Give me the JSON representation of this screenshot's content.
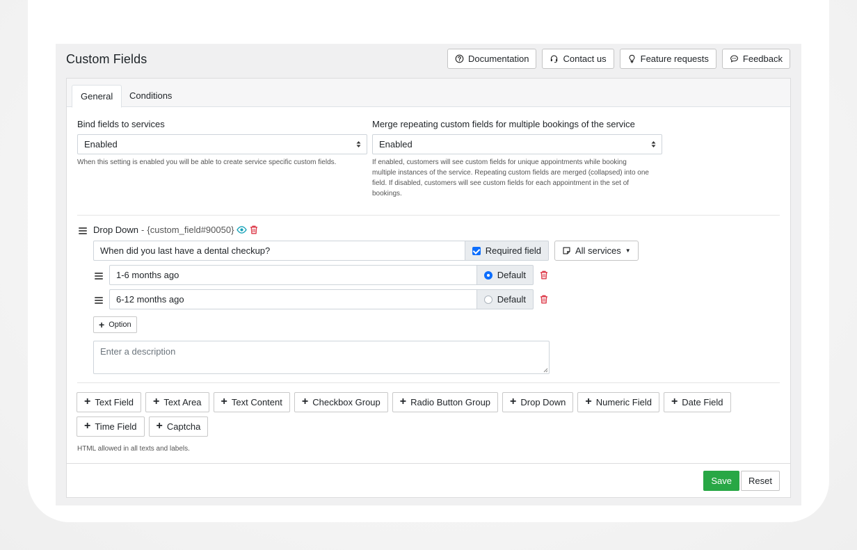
{
  "header": {
    "title": "Custom Fields",
    "buttons": [
      {
        "label": "Documentation",
        "icon": "question-circle-icon"
      },
      {
        "label": "Contact us",
        "icon": "headset-icon"
      },
      {
        "label": "Feature requests",
        "icon": "lightbulb-icon"
      },
      {
        "label": "Feedback",
        "icon": "chat-icon"
      }
    ]
  },
  "tabs": [
    {
      "label": "General",
      "active": true
    },
    {
      "label": "Conditions",
      "active": false
    }
  ],
  "settings": {
    "bind": {
      "label": "Bind fields to services",
      "value": "Enabled",
      "help": "When this setting is enabled you will be able to create service specific custom fields."
    },
    "merge": {
      "label": "Merge repeating custom fields for multiple bookings of the service",
      "value": "Enabled",
      "help_lines": [
        "If enabled, customers will see custom fields for unique appointments while booking",
        "multiple instances of the service. Repeating custom fields are merged (collapsed) into one",
        "field. If disabled, customers will see custom fields for each appointment in the set of",
        "bookings."
      ]
    }
  },
  "field": {
    "type": "Drop Down",
    "separator": " - ",
    "code": "{custom_field#90050}",
    "question": "When did you last have a dental checkup?",
    "required_label": "Required field",
    "required": true,
    "services_label": "All services",
    "options": [
      {
        "value": "1-6 months ago",
        "default_label": "Default",
        "is_default": true
      },
      {
        "value": "6-12 months ago",
        "default_label": "Default",
        "is_default": false
      }
    ],
    "add_option_label": "Option",
    "description_placeholder": "Enter a description"
  },
  "add_buttons": [
    "Text Field",
    "Text Area",
    "Text Content",
    "Checkbox Group",
    "Radio Button Group",
    "Drop Down",
    "Numeric Field",
    "Date Field",
    "Time Field",
    "Captcha"
  ],
  "html_note": "HTML allowed in all texts and labels.",
  "footer": {
    "save": "Save",
    "reset": "Reset"
  },
  "colors": {
    "primary": "#0d6efd",
    "success": "#28a745",
    "danger": "#dc3545",
    "info": "#17a2b8"
  }
}
